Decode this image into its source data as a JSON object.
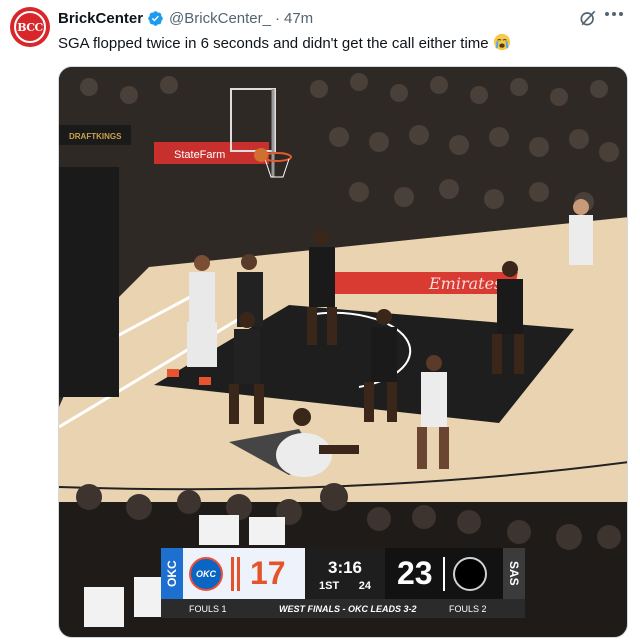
{
  "tweet": {
    "avatar_logo": "BCC",
    "display_name": "BrickCenter",
    "handle": "@BrickCenter_",
    "separator": "·",
    "time": "47m",
    "text": "SGA flopped twice in 6 seconds and didn't get the call either time",
    "emoji": "crying-face-emoji"
  },
  "icons": {
    "verified": "verified-badge-icon",
    "grok": "grok-icon",
    "more": "more-icon"
  },
  "media": {
    "court_ads": [
      "StateFarm",
      "Emirates",
      "DRAFTKINGS"
    ],
    "scorebug": {
      "team_left": "OKC",
      "score_left": "17",
      "clock": "3:16",
      "period": "1ST",
      "shot_clock": "24",
      "team_right": "SAS",
      "score_right": "23",
      "fouls_left": "FOULS 1",
      "series": "WEST FINALS - OKC LEADS 3-2",
      "fouls_right": "FOULS 2"
    }
  },
  "colors": {
    "verified_blue": "#1d9bf0",
    "brand_red": "#d8262b",
    "okc_blue": "#1d6fd0",
    "okc_orange": "#e4542b"
  }
}
